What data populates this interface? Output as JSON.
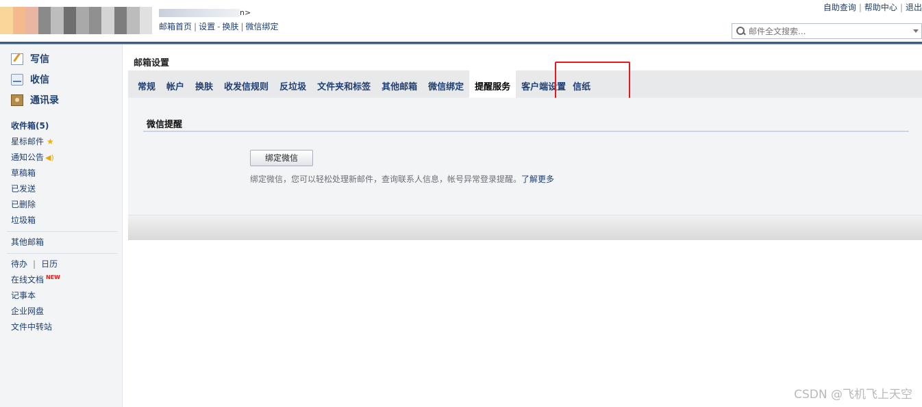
{
  "header": {
    "account_suffix": "n>",
    "nav": [
      "邮箱首页",
      "设置",
      "换肤",
      "微信绑定"
    ],
    "nav_seps": [
      "|",
      "-",
      "|"
    ],
    "top_links": [
      "自助查询",
      "帮助中心",
      "退出"
    ],
    "search_placeholder": "邮件全文搜索..."
  },
  "sidebar": {
    "main_actions": [
      {
        "label": "写信",
        "icon": "write-icon"
      },
      {
        "label": "收信",
        "icon": "inbox-icon"
      },
      {
        "label": "通讯录",
        "icon": "contacts-icon"
      }
    ],
    "folders": [
      "收件箱(5)",
      "星标邮件",
      "通知公告",
      "草稿箱",
      "已发送",
      "已删除",
      "垃圾箱"
    ],
    "other_mailbox": "其他邮箱",
    "tools": {
      "todo": "待办",
      "calendar": "日历",
      "online_docs": "在线文档",
      "new_badge": "NEW",
      "notebook": "记事本",
      "netdisk": "企业网盘",
      "file_transfer": "文件中转站"
    }
  },
  "main": {
    "page_title": "邮箱设置",
    "tabs": [
      "常规",
      "帐户",
      "换肤",
      "收发信规则",
      "反垃圾",
      "文件夹和标签",
      "其他邮箱",
      "微信绑定",
      "提醒服务",
      "客户端设置",
      "信纸"
    ],
    "active_tab": "提醒服务",
    "section_title": "微信提醒",
    "bind_button": "绑定微信",
    "description": "绑定微信，您可以轻松处理新邮件，查询联系人信息，帐号异常登录提醒。",
    "learn_more": "了解更多"
  },
  "watermark": "CSDN @飞机飞上天空",
  "colors": {
    "link": "#1f3f72",
    "header_rule": "#3c5d87",
    "highlight": "#e8171b",
    "panel": "#f3f4f6"
  }
}
